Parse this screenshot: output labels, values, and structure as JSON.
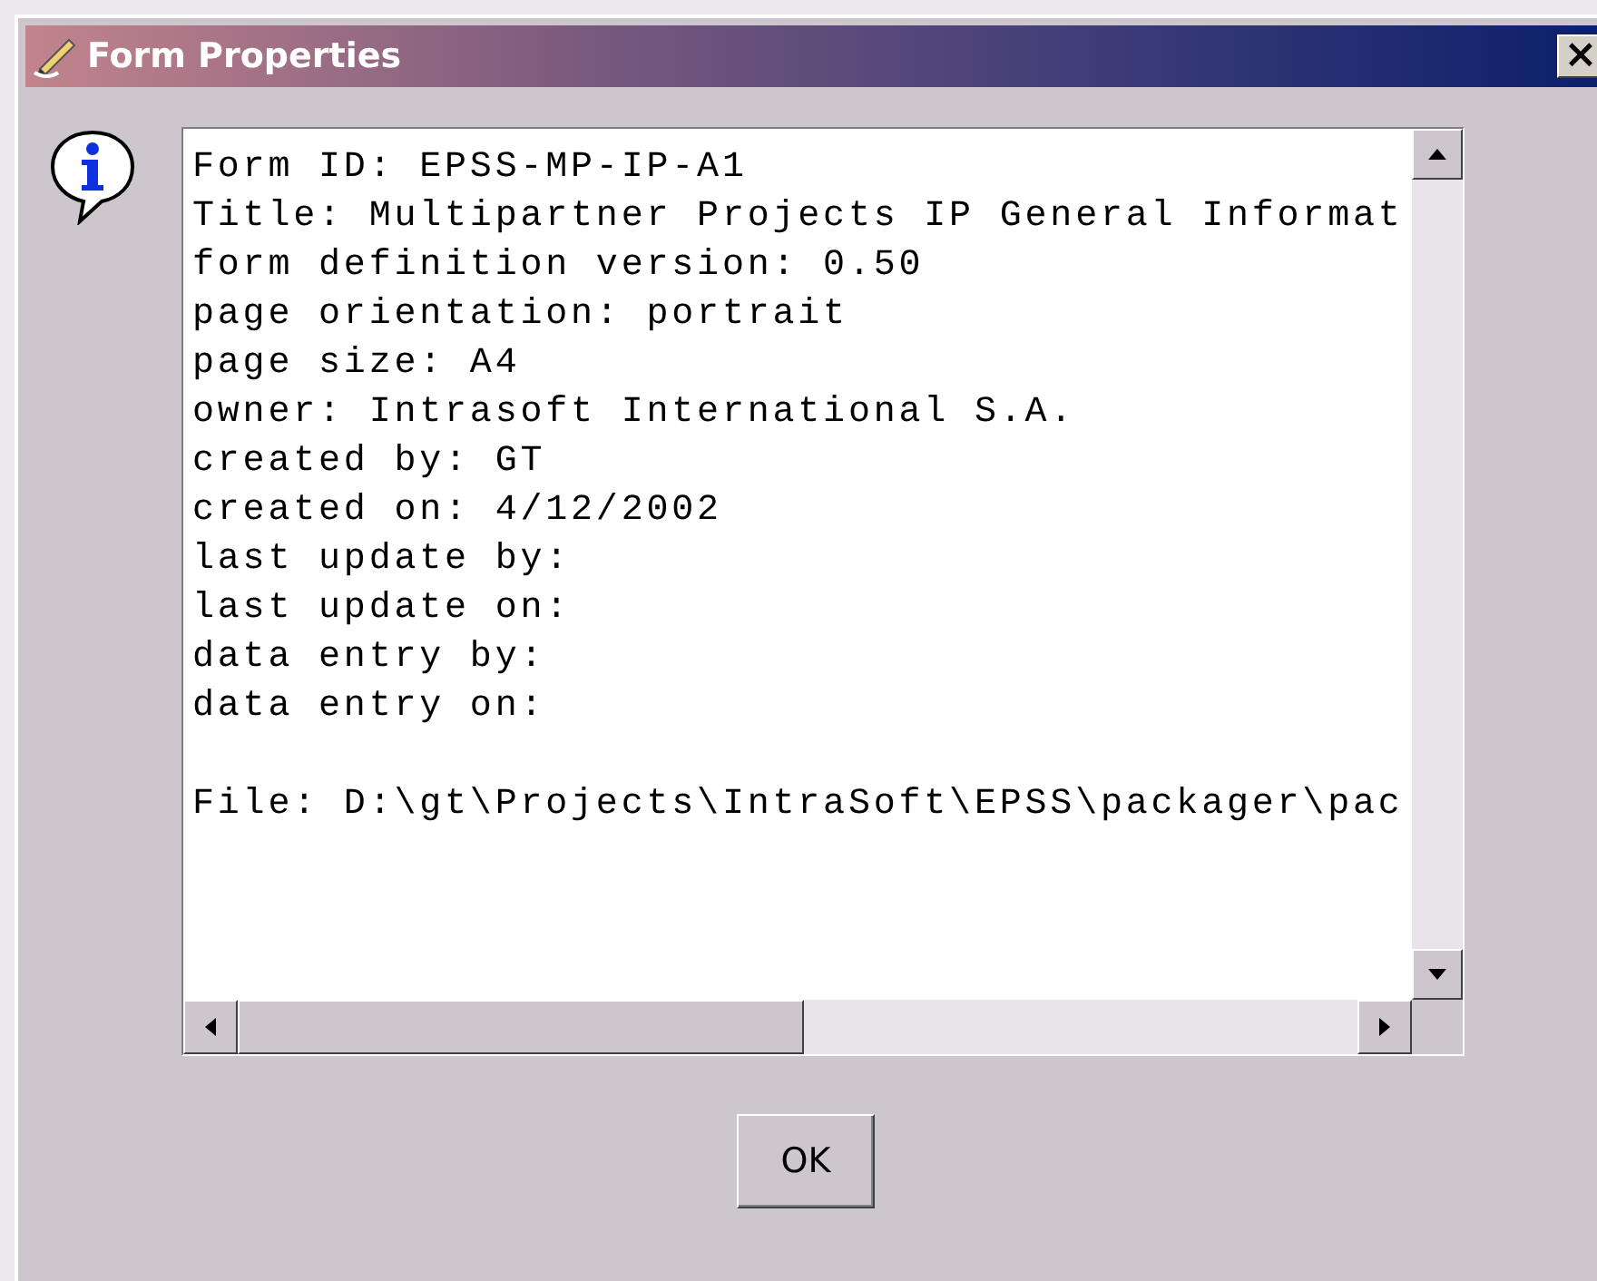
{
  "window": {
    "title": "Form Properties",
    "close": "×"
  },
  "properties": {
    "lines": [
      "Form ID: EPSS-MP-IP-A1",
      "Title: Multipartner Projects IP General Informat",
      "form definition version: 0.50",
      "page orientation: portrait",
      "page size: A4",
      "owner: Intrasoft International S.A.",
      "created by: GT",
      "created on: 4/12/2002",
      "last update by:",
      "last update on:",
      "data entry by:",
      "data entry on:"
    ],
    "file_line": "File: D:\\gt\\Projects\\IntraSoft\\EPSS\\packager\\pac"
  },
  "buttons": [
    {
      "label": "OK"
    }
  ]
}
